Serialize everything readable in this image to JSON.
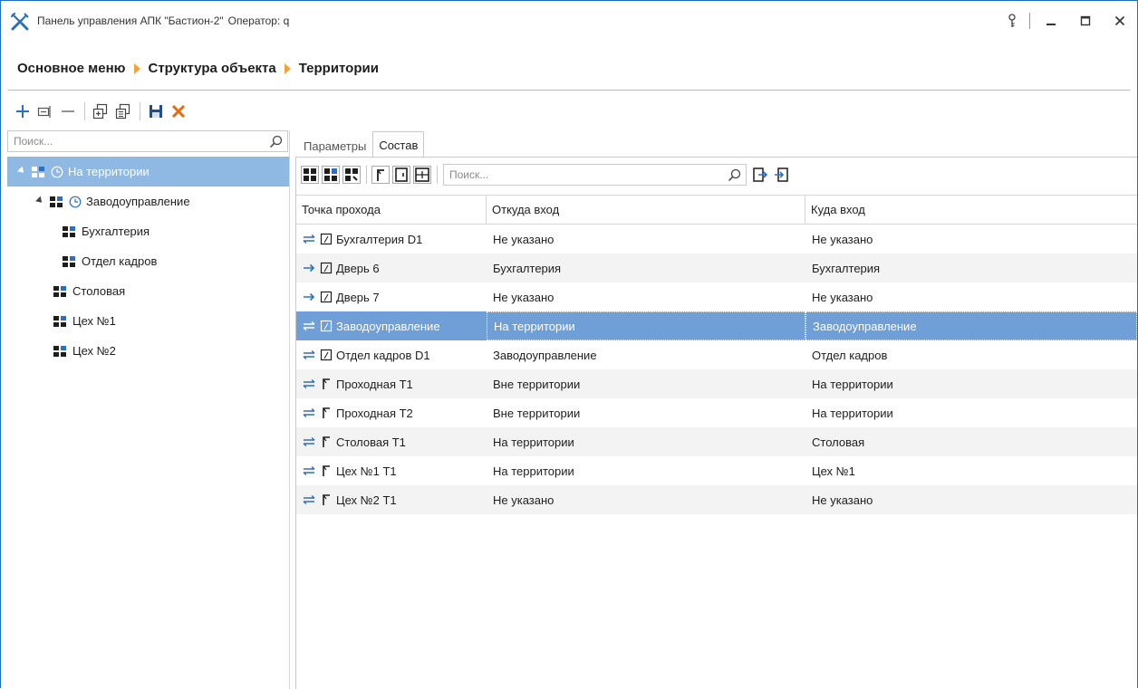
{
  "window": {
    "title": "Панель управления АПК \"Бастион-2\"",
    "operator": "Оператор: q"
  },
  "breadcrumb": [
    "Основное меню",
    "Структура объекта",
    "Территории"
  ],
  "toolbar": {
    "icons": [
      "add-icon",
      "edit-icon",
      "remove-icon",
      "copy-icon",
      "paste-icon",
      "save-icon",
      "cancel-icon"
    ]
  },
  "left": {
    "search_placeholder": "Поиск...",
    "tree": [
      {
        "label": "На территории",
        "level": 0,
        "expanded": true,
        "clock": true,
        "selected": true
      },
      {
        "label": "Заводоуправление",
        "level": 1,
        "expanded": true,
        "clock": true,
        "selected": false
      },
      {
        "label": "Бухгалтерия",
        "level": 2,
        "clock": false
      },
      {
        "label": "Отдел кадров",
        "level": 2,
        "clock": false
      },
      {
        "label": "Столовая",
        "level": 1,
        "clock": false
      },
      {
        "label": "Цех №1",
        "level": 1,
        "clock": false
      },
      {
        "label": "Цех №2",
        "level": 1,
        "clock": false
      }
    ]
  },
  "tabs": [
    {
      "label": "Параметры",
      "active": false
    },
    {
      "label": "Состав",
      "active": true
    }
  ],
  "grid": {
    "search_placeholder": "Поиск...",
    "columns": [
      "Точка прохода",
      "Откуда вход",
      "Куда вход"
    ],
    "rows": [
      {
        "direction": "both",
        "type": "door",
        "point": "Бухгалтерия D1",
        "from": "Не указано",
        "to": "Не указано"
      },
      {
        "direction": "one",
        "type": "door",
        "point": "Дверь 6",
        "from": "Бухгалтерия",
        "to": "Бухгалтерия"
      },
      {
        "direction": "one",
        "type": "door",
        "point": "Дверь 7",
        "from": "Не указано",
        "to": "Не указано"
      },
      {
        "direction": "both",
        "type": "door",
        "point": "Заводоуправление",
        "from": "На территории",
        "to": "Заводоуправление",
        "selected": true
      },
      {
        "direction": "both",
        "type": "door",
        "point": "Отдел кадров D1",
        "from": "Заводоуправление",
        "to": "Отдел кадров"
      },
      {
        "direction": "both",
        "type": "turnstile",
        "point": "Проходная Т1",
        "from": "Вне территории",
        "to": "На территории"
      },
      {
        "direction": "both",
        "type": "turnstile",
        "point": "Проходная Т2",
        "from": "Вне территории",
        "to": "На территории"
      },
      {
        "direction": "both",
        "type": "turnstile",
        "point": "Столовая Т1",
        "from": "На территории",
        "to": "Столовая"
      },
      {
        "direction": "both",
        "type": "turnstile",
        "point": "Цех №1 Т1",
        "from": "На территории",
        "to": "Цех №1"
      },
      {
        "direction": "both",
        "type": "turnstile",
        "point": "Цех №2 Т1",
        "from": "Не указано",
        "to": "Не указано"
      }
    ]
  },
  "colors": {
    "accent": "#1c6fbd",
    "selection": "#6f9fd6",
    "tree_selection": "#8fb8e3",
    "breadcrumb_arrow": "#f2a33a",
    "cancel": "#e06b10"
  }
}
